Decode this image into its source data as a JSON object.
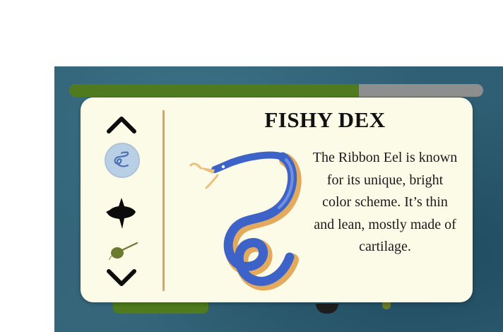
{
  "dex": {
    "title": "FISHY DEX",
    "description": "The Ribbon Eel is known for its unique, bright color scheme. It’s thin and lean, mostly made of cartilage."
  },
  "progress": {
    "fraction": 0.7
  },
  "icons": {
    "up": "chevron-up-icon",
    "down": "chevron-down-icon",
    "selected": "ribbon-eel-icon",
    "slot2": "sunfish-silhouette-icon",
    "slot3": "anglerfish-icon"
  },
  "colors": {
    "progress_fill": "#4f7a1e",
    "progress_track": "#8d8f8e",
    "card": "#fcfbe7",
    "selected_bubble": "#b9cfe6",
    "eel_blue": "#3d63c9",
    "eel_gold": "#e3a95c"
  }
}
